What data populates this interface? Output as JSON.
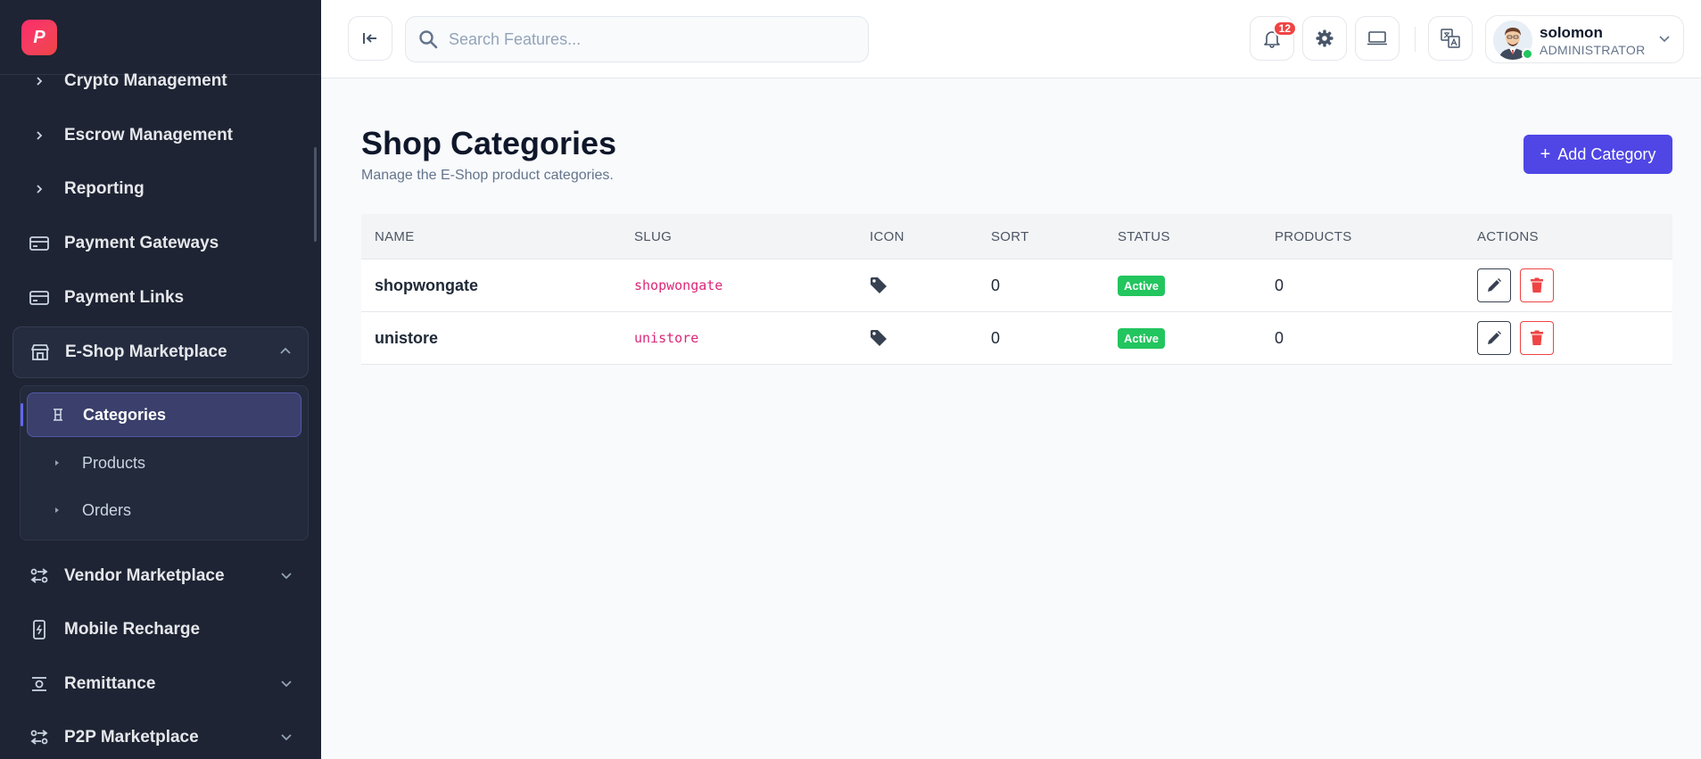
{
  "sidebar": {
    "items": [
      {
        "label": "Crypto Management",
        "icon": "chevron-right-icon"
      },
      {
        "label": "Escrow Management",
        "icon": "chevron-right-icon"
      },
      {
        "label": "Reporting",
        "icon": "chevron-right-icon"
      },
      {
        "label": "Payment Gateways",
        "icon": "card-icon"
      },
      {
        "label": "Payment Links",
        "icon": "card-icon"
      },
      {
        "label": "E-Shop Marketplace",
        "icon": "store-icon"
      },
      {
        "label": "Vendor Marketplace",
        "icon": "vendor-icon"
      },
      {
        "label": "Mobile Recharge",
        "icon": "mobile-icon"
      },
      {
        "label": "Remittance",
        "icon": "remittance-icon"
      },
      {
        "label": "P2P Marketplace",
        "icon": "p2p-icon"
      }
    ],
    "submenu": [
      {
        "label": "Categories",
        "active": true
      },
      {
        "label": "Products",
        "active": false
      },
      {
        "label": "Orders",
        "active": false
      }
    ]
  },
  "header": {
    "search_placeholder": "Search Features...",
    "notification_count": "12",
    "user": {
      "name": "solomon",
      "role": "ADMINISTRATOR"
    }
  },
  "main": {
    "title": "Shop Categories",
    "subtitle": "Manage the E-Shop product categories.",
    "add_button": "Add Category",
    "columns": [
      "NAME",
      "SLUG",
      "ICON",
      "SORT",
      "STATUS",
      "PRODUCTS",
      "ACTIONS"
    ],
    "rows": [
      {
        "name": "shopwongate",
        "slug": "shopwongate",
        "icon": "tag-icon",
        "sort": "0",
        "status": "Active",
        "products": "0"
      },
      {
        "name": "unistore",
        "slug": "unistore",
        "icon": "tag-icon",
        "sort": "0",
        "status": "Active",
        "products": "0"
      }
    ]
  },
  "colors": {
    "sidebar_bg": "#1e2433",
    "accent": "#4f46e5",
    "status_active": "#22c55e",
    "danger": "#ef4444",
    "slug": "#db2777"
  }
}
